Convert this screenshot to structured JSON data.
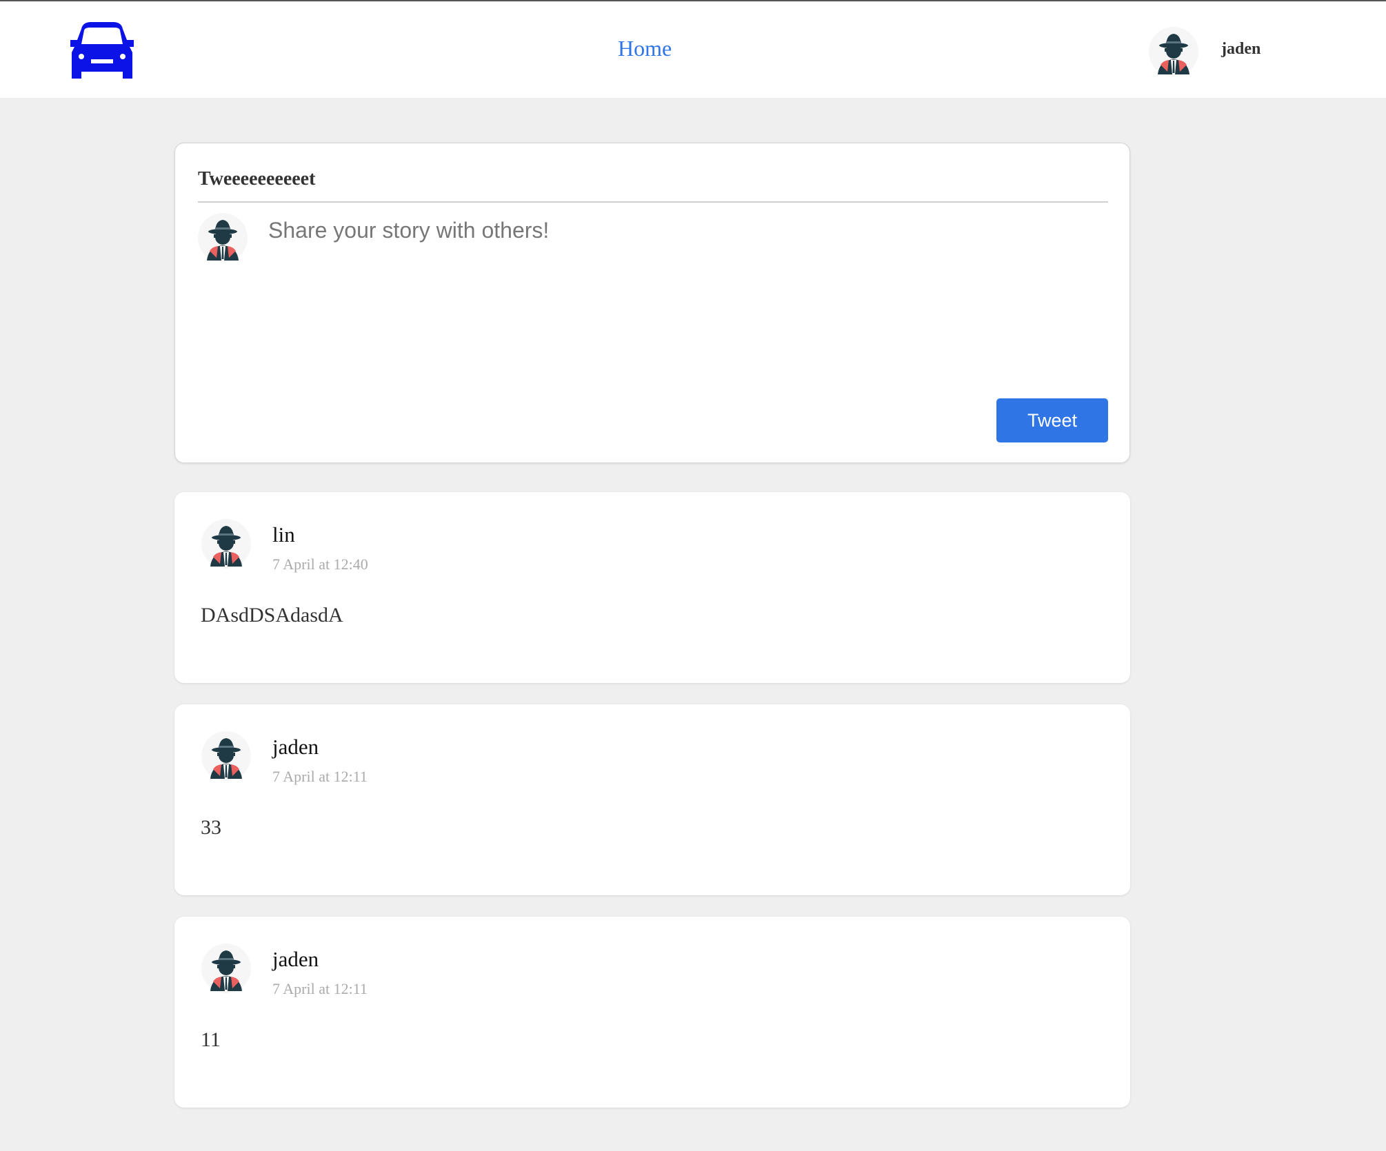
{
  "navbar": {
    "logo_icon": "car-icon",
    "logo_color": "#0b13e6",
    "home_label": "Home",
    "user": {
      "name": "jaden",
      "avatar_icon": "spy-avatar-icon"
    }
  },
  "compose": {
    "title": "Tweeeeeeeeeet",
    "placeholder": "Share your story with others!",
    "value": "",
    "button_label": "Tweet",
    "accent_color": "#2f75e6"
  },
  "posts": [
    {
      "author": "lin",
      "time": "7 April at 12:40",
      "content": "DAsdDSAdasdA"
    },
    {
      "author": "jaden",
      "time": "7 April at 12:11",
      "content": "33"
    },
    {
      "author": "jaden",
      "time": "7 April at 12:11",
      "content": "11"
    }
  ]
}
